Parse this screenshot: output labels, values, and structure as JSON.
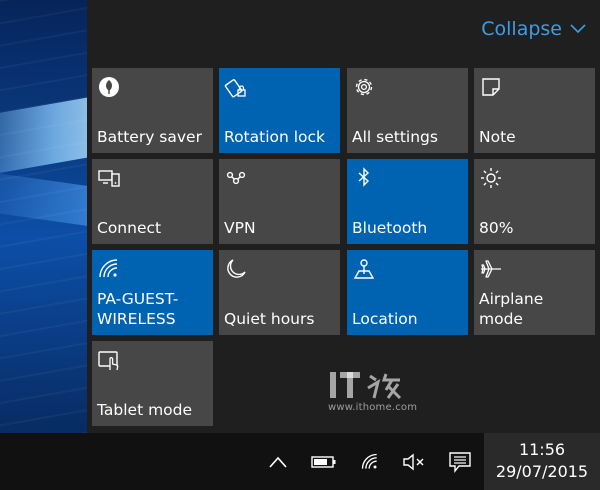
{
  "action_center": {
    "collapse_label": "Collapse",
    "accent_color": "#0063b1",
    "tiles": [
      {
        "label": "Battery saver",
        "icon": "leaf-icon",
        "active": false
      },
      {
        "label": "Rotation lock",
        "icon": "rotation-lock-icon",
        "active": true
      },
      {
        "label": "All settings",
        "icon": "gear-icon",
        "active": false
      },
      {
        "label": "Note",
        "icon": "note-icon",
        "active": false
      },
      {
        "label": "Connect",
        "icon": "connect-icon",
        "active": false
      },
      {
        "label": "VPN",
        "icon": "vpn-icon",
        "active": false
      },
      {
        "label": "Bluetooth",
        "icon": "bluetooth-icon",
        "active": true
      },
      {
        "label": "80%",
        "icon": "brightness-icon",
        "active": false
      },
      {
        "label": "PA-GUEST-\nWIRELESS",
        "icon": "wifi-icon",
        "active": true
      },
      {
        "label": "Quiet hours",
        "icon": "moon-icon",
        "active": false
      },
      {
        "label": "Location",
        "icon": "location-icon",
        "active": true
      },
      {
        "label": "Airplane mode",
        "icon": "airplane-icon",
        "active": false
      },
      {
        "label": "Tablet mode",
        "icon": "tablet-mode-icon",
        "active": false
      }
    ]
  },
  "watermark": {
    "logo_text": "IT之家",
    "url": "www.ithome.com"
  },
  "taskbar": {
    "time": "11:56",
    "date": "29/07/2015",
    "tray_icons": [
      "chevron-up-icon",
      "battery-icon",
      "wifi-icon",
      "volume-muted-icon",
      "notification-icon"
    ]
  }
}
